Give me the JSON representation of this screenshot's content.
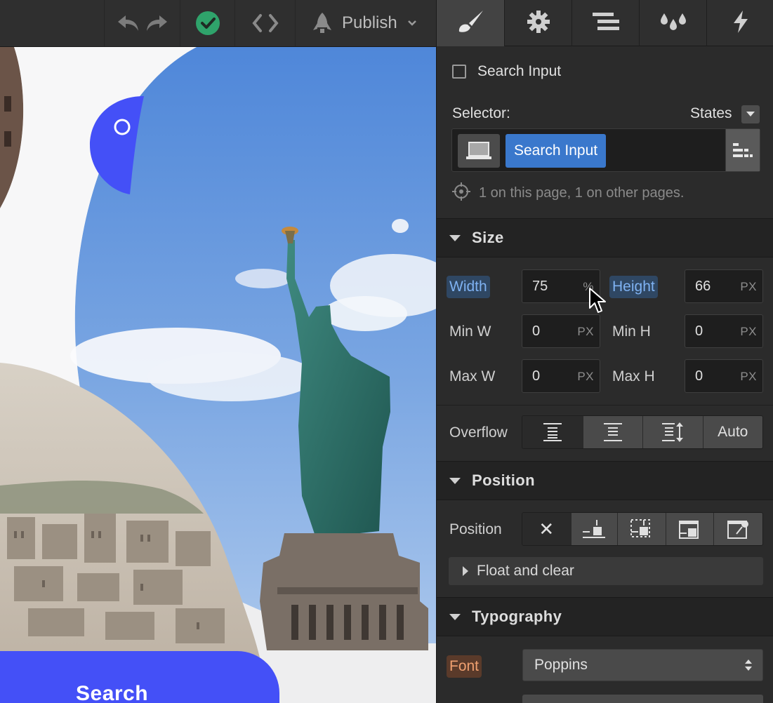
{
  "toolbar": {
    "publish_label": "Publish",
    "icons": [
      "undo-icon",
      "redo-icon",
      "check-circle-icon",
      "code-icon",
      "rocket-icon",
      "chevron-down-icon"
    ],
    "colors": {
      "check": "#2fa36b"
    }
  },
  "canvas": {
    "search_button_label": "Search",
    "colors": {
      "accent": "#4450f7"
    }
  },
  "panel": {
    "tabs": [
      {
        "name": "style",
        "icon": "paintbrush-icon",
        "active": true
      },
      {
        "name": "settings",
        "icon": "gear-icon"
      },
      {
        "name": "navigator",
        "icon": "layers-icon"
      },
      {
        "name": "interactions",
        "icon": "drops-icon"
      },
      {
        "name": "lightning",
        "icon": "lightning-icon"
      }
    ],
    "element_name": "Search Input",
    "selector_label": "Selector:",
    "states_label": "States",
    "selector_chip": "Search Input",
    "usage_text": "1 on this page, 1 on other pages.",
    "size": {
      "title": "Size",
      "width_label": "Width",
      "width_value": "75",
      "width_unit": "%",
      "height_label": "Height",
      "height_value": "66",
      "height_unit": "PX",
      "minw_label": "Min W",
      "minw_value": "0",
      "minw_unit": "PX",
      "minh_label": "Min H",
      "minh_value": "0",
      "minh_unit": "PX",
      "maxw_label": "Max W",
      "maxw_value": "0",
      "maxw_unit": "PX",
      "maxh_label": "Max H",
      "maxh_value": "0",
      "maxh_unit": "PX",
      "overflow_label": "Overflow",
      "overflow_auto": "Auto"
    },
    "position": {
      "title": "Position",
      "label": "Position",
      "none_glyph": "✕",
      "float_label": "Float and clear"
    },
    "typography": {
      "title": "Typography",
      "font_label": "Font",
      "font_value": "Poppins"
    },
    "colors": {
      "selector_chip": "#3a78cc",
      "set_label": "#7fb2f2",
      "font_label": "#f0a070"
    }
  }
}
